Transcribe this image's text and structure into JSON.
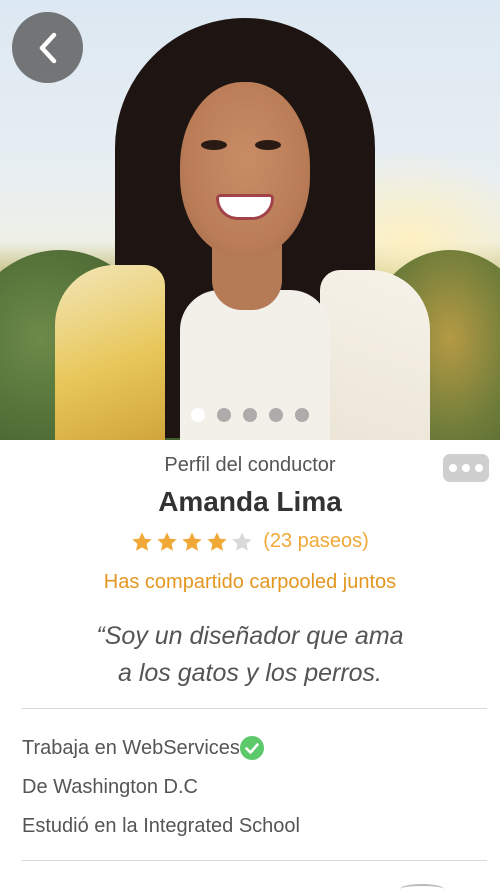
{
  "header": {
    "back_icon": "chevron-left-icon",
    "photo_count": 5,
    "active_photo": 1
  },
  "profile": {
    "subtitle": "Perfil del conductor",
    "more_icon": "ellipsis-icon",
    "name": "Amanda Lima",
    "rating": 4,
    "rating_max": 5,
    "rides_label": "(23 paseos)",
    "shared_label": "Has compartido carpooled juntos",
    "quote_line1": "“Soy un diseñador que ama",
    "quote_line2": "a los gatos y los perros."
  },
  "details": {
    "work": "Trabaja en WebServices",
    "work_verified_icon": "check-circle-icon",
    "from": "De Washington D.C",
    "studied": "Estudió en la Integrated School"
  },
  "colors": {
    "accent": "#f0a838",
    "shared_text": "#e39720",
    "verified": "#5cc96b",
    "star_empty": "#d9d9d9"
  }
}
